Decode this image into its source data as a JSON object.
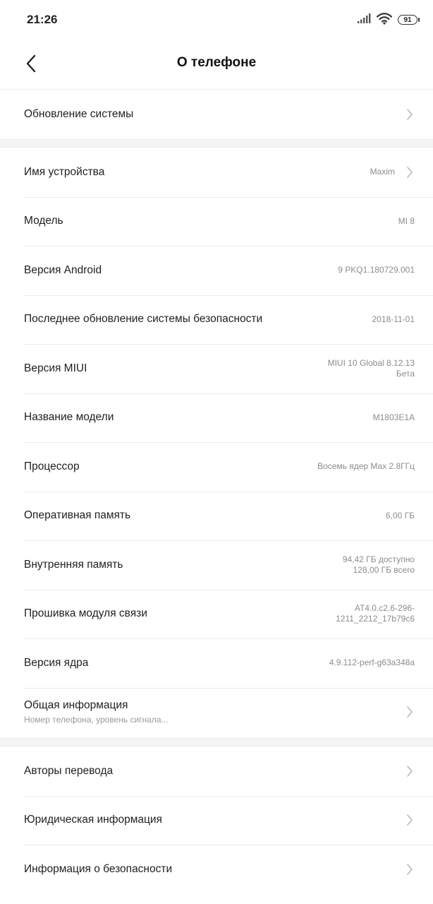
{
  "status_bar": {
    "time": "21:26",
    "battery": "91",
    "icons": [
      "signal-icon",
      "wifi-icon",
      "battery-icon"
    ]
  },
  "header": {
    "title": "О телефоне",
    "back_icon": "back-arrow-icon"
  },
  "section1": {
    "items": [
      {
        "label": "Обновление системы",
        "has_chevron": true
      }
    ]
  },
  "section2": {
    "items": [
      {
        "label": "Имя устройства",
        "value": "Maxim",
        "has_chevron": true
      },
      {
        "label": "Модель",
        "value": "MI 8"
      },
      {
        "label": "Версия Android",
        "value": "9 PKQ1.180729.001"
      },
      {
        "label": "Последнее обновление системы безопасности",
        "value": "2018-11-01"
      },
      {
        "label": "Версия MIUI",
        "value_lines": [
          "MIUI 10 Global 8.12.13",
          "Бета"
        ]
      },
      {
        "label": "Название модели",
        "value": "M1803E1A"
      },
      {
        "label": "Процессор",
        "value": "Восемь ядер Max 2.8ГГц"
      },
      {
        "label": "Оперативная память",
        "value": "6,00 ГБ"
      },
      {
        "label": "Внутренняя память",
        "value_lines": [
          "94,42 ГБ доступно",
          "128,00 ГБ всего"
        ]
      },
      {
        "label": "Прошивка модуля связи",
        "value_lines": [
          "AT4.0.c2.6-296-",
          "1211_2212_17b79c6"
        ]
      },
      {
        "label": "Версия ядра",
        "value": "4.9.112-perf-g63a348a"
      },
      {
        "label": "Общая информация",
        "sublabel": "Номер телефона, уровень сигнала...",
        "has_chevron": true
      }
    ]
  },
  "section3": {
    "items": [
      {
        "label": "Авторы перевода",
        "has_chevron": true
      },
      {
        "label": "Юридическая информация",
        "has_chevron": true
      },
      {
        "label": "Информация о безопасности",
        "has_chevron": true
      }
    ]
  },
  "colors": {
    "background": "#ffffff",
    "band": "#f4f4f4",
    "label": "#1f1f1f",
    "value": "#8c8c8c",
    "chevron": "#b8b8b8"
  }
}
